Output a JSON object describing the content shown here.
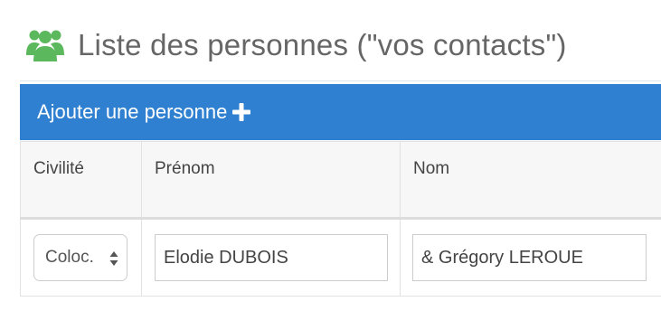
{
  "header": {
    "title": "Liste des personnes (\"vos contacts\")",
    "icon": "users-icon",
    "icon_color": "#5cb85c"
  },
  "add_bar": {
    "label": "Ajouter une personne",
    "icon": "plus-icon",
    "background": "#2f80d0"
  },
  "table": {
    "columns": [
      "Civilité",
      "Prénom",
      "Nom"
    ],
    "rows": [
      {
        "civilite": "Coloc.",
        "prenom": "Elodie DUBOIS",
        "nom": "& Grégory LEROUE"
      }
    ]
  }
}
